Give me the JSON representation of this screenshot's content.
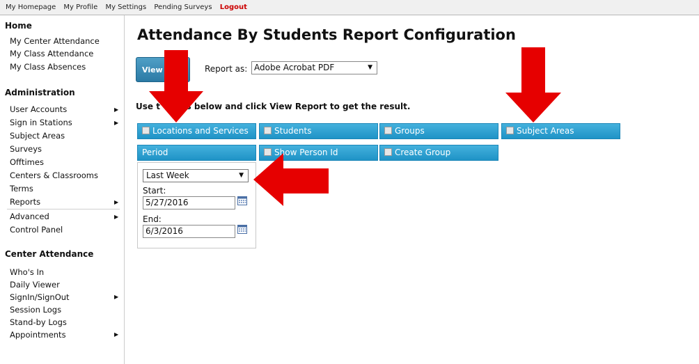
{
  "topnav": {
    "links": [
      "My Homepage",
      "My Profile",
      "My Settings",
      "Pending Surveys"
    ],
    "logout": "Logout"
  },
  "sidebar": {
    "home": {
      "title": "Home",
      "items": [
        "My Center Attendance",
        "My Class Attendance",
        "My Class Absences"
      ]
    },
    "administration": {
      "title": "Administration",
      "items": [
        {
          "label": "User Accounts",
          "submenu": true
        },
        {
          "label": "Sign in Stations",
          "submenu": true
        },
        {
          "label": "Subject Areas",
          "submenu": false
        },
        {
          "label": "Surveys",
          "submenu": false
        },
        {
          "label": "Offtimes",
          "submenu": false
        },
        {
          "label": "Centers & Classrooms",
          "submenu": false
        },
        {
          "label": "Terms",
          "submenu": false
        },
        {
          "label": "Reports",
          "submenu": true
        },
        {
          "label": "Advanced",
          "submenu": true
        },
        {
          "label": "Control Panel",
          "submenu": false
        }
      ]
    },
    "center_attendance": {
      "title": "Center Attendance",
      "items": [
        {
          "label": "Who's In",
          "submenu": false
        },
        {
          "label": "Daily Viewer",
          "submenu": false
        },
        {
          "label": "SignIn/SignOut",
          "submenu": true
        },
        {
          "label": "Session Logs",
          "submenu": false
        },
        {
          "label": "Stand-by Logs",
          "submenu": false
        },
        {
          "label": "Appointments",
          "submenu": true
        }
      ]
    }
  },
  "main": {
    "title": "Attendance By Students Report Configuration",
    "view_report_label": "View R",
    "report_as_label": "Report as:",
    "report_as_value": "Adobe Acrobat PDF",
    "instructions": "Use t         s below and click View Report to get the result.",
    "options": {
      "locations": "Locations and Services",
      "students": "Students",
      "groups": "Groups",
      "subject_areas": "Subject Areas",
      "period": "Period",
      "show_person_id": "Show Person Id",
      "create_group": "Create Group"
    },
    "period_panel": {
      "range": "Last Week",
      "start_label": "Start:",
      "start_value": "5/27/2016",
      "end_label": "End:",
      "end_value": "6/3/2016"
    }
  },
  "colors": {
    "option_button": "#2aa0d2",
    "view_report_button": "#3a8cb8",
    "annotation_arrow": "#e60000",
    "logout": "#cc0000"
  }
}
